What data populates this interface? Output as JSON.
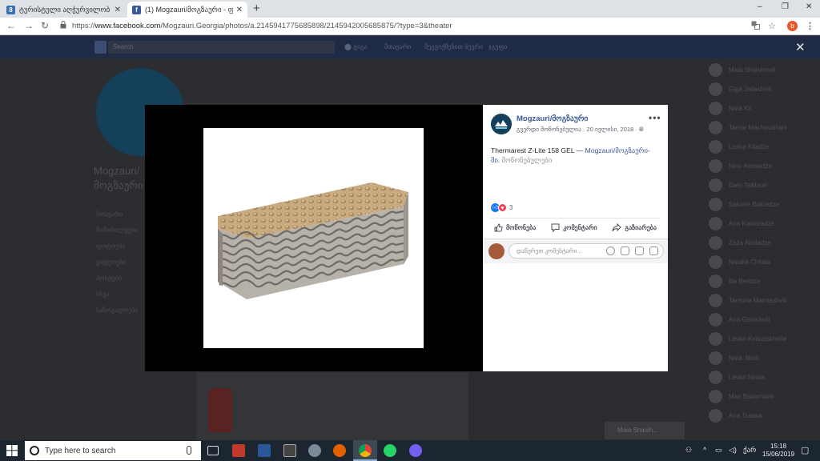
{
  "browser": {
    "tabs": [
      {
        "title": "ტურისტული აღჭურვილობ",
        "favicon": "8",
        "favicon_color": "#3b6fb5",
        "active": false
      },
      {
        "title": "(1) Mogzauri/მოგზაური - ფო",
        "favicon": "f",
        "favicon_color": "#3b5998",
        "active": true
      }
    ],
    "new_tab": "+",
    "window_controls": {
      "minimize": "–",
      "maximize": "❐",
      "close": "✕"
    },
    "url_prefix": "https://",
    "url_host": "www.facebook.com",
    "url_path": "/Mogzauri.Georgia/photos/a.2145941775685898/2145942005685875/?type=3&theater",
    "profile_initial": "b"
  },
  "facebook_bg": {
    "search_placeholder": "Search",
    "page_name_line1": "Mogzauri/",
    "page_name_line2": "მოგზაური",
    "menu_items": [
      "მთავარი",
      "მიმოხილვები",
      "ფოტოები",
      "ვიდეოები",
      "პოსტები",
      "სხვა",
      "საზოგადოება"
    ],
    "chat_contacts": [
      "Maia Shaishmeli",
      "Giga Jaliashvili",
      "Nata Kit",
      "Tamar Machavariani",
      "Lasha Kiladze",
      "Nino Abesadze",
      "Dato Tsiklauri",
      "Salome Bakradze",
      "Ana Kavtaradze",
      "Zaza Abuladze",
      "Natalia Chitaia",
      "Ilia Beridze",
      "Tamuna Mamiashvili",
      "Ana Gelashvili",
      "Levan Kvaratskhelia",
      "Nata Jibuti",
      "Levan Ninua",
      "Mari Bairamova",
      "Ana Tsaava"
    ],
    "chat_tab_name": "Maia Shaish..."
  },
  "post": {
    "page_name": "Mogzauri/მოგზაური",
    "meta": "გვერდი მოწონებულია · 20 ივლისი, 2018 · ",
    "globe_icon": "globe-icon",
    "more_menu": "•••",
    "text_main": "Thermarest Z-Lite 158 GEL — ",
    "text_link": "Mogzauri/მოგზაური-ში.",
    "text_tag": " მოწონებულები",
    "reaction_count": "3",
    "actions": {
      "like": "მოწონება",
      "comment": "კომენტარი",
      "share": "გაზიარება"
    },
    "comment_placeholder": "დაწერეთ კომენტარი..."
  },
  "taskbar": {
    "search_placeholder": "Type here to search",
    "time": "15:18",
    "date": "15/06/2019",
    "lang": "ქარ"
  },
  "colors": {
    "fb_blue": "#385898",
    "like_blue": "#1877f2",
    "love_red": "#f33e58",
    "taskbar": "#1c2631"
  }
}
